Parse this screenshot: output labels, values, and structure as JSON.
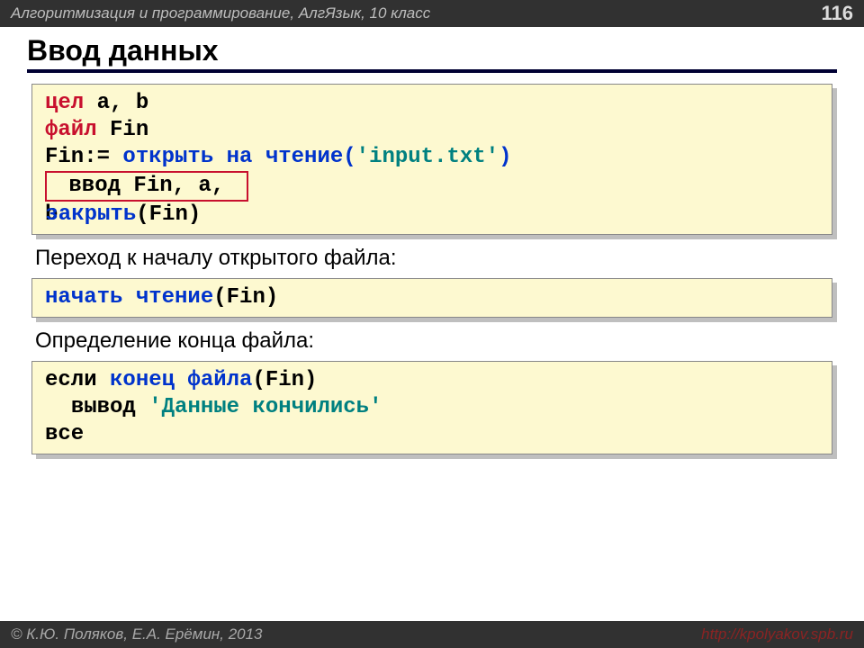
{
  "header": {
    "course": "Алгоритмизация и программирование, АлгЯзык, 10 класс",
    "page": "116"
  },
  "title": "Ввод данных",
  "code1": {
    "line1_kw": "цел",
    "line1_rest": " a, b",
    "line2_kw": "файл",
    "line2_rest": " Fin",
    "line3_lhs": "Fin:=",
    "line3_fn": " открыть на чтение(",
    "line3_str": "'input.txt'",
    "line3_close": ")",
    "inner_code": " ввод Fin, a, ",
    "line5_b": "b",
    "line5_fn": "закрыть",
    "line5_arg": "(Fin)"
  },
  "sub1": "Переход к началу открытого файла:",
  "code2": {
    "fn": "начать чтение",
    "arg": "(Fin)"
  },
  "sub2": "Определение конца файла:",
  "code3": {
    "kw_if": "если",
    "fn_eof": " конец файла",
    "arg_eof": "(Fin)",
    "kw_out": "  вывод ",
    "str": "'Данные кончились'",
    "kw_all": "все"
  },
  "footer": {
    "left": "© К.Ю. Поляков, Е.А. Ерёмин, 2013",
    "right": "http://kpolyakov.spb.ru"
  }
}
